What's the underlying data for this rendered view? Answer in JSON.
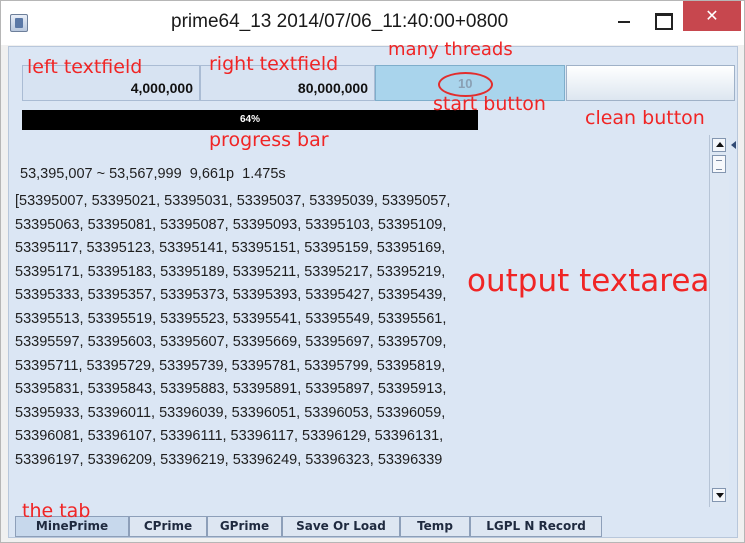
{
  "window": {
    "title": "prime64_13   2014/07/06_11:40:00+0800",
    "close_glyph": "✕"
  },
  "controls": {
    "left_field_value": "4,000,000",
    "right_field_value": "80,000,000",
    "threads_value": "10",
    "progress_percent": 64,
    "progress_text": "64%"
  },
  "output": {
    "summary": "53,395,007 ~ 53,567,999  9,661p  1.475s",
    "lines": [
      "[53395007, 53395021, 53395031, 53395037, 53395039, 53395057,",
      "53395063, 53395081, 53395087, 53395093, 53395103, 53395109,",
      "53395117, 53395123, 53395141, 53395151, 53395159, 53395169,",
      "53395171, 53395183, 53395189, 53395211, 53395217, 53395219,",
      "53395333, 53395357, 53395373, 53395393, 53395427, 53395439,",
      "53395513, 53395519, 53395523, 53395541, 53395549, 53395561,",
      "53395597, 53395603, 53395607, 53395669, 53395697, 53395709,",
      "53395711, 53395729, 53395739, 53395781, 53395799, 53395819,",
      "53395831, 53395843, 53395883, 53395891, 53395897, 53395913,",
      "53395933, 53396011, 53396039, 53396051, 53396053, 53396059,",
      "53396081, 53396107, 53396111, 53396117, 53396129, 53396131,",
      "53396197, 53396209, 53396219, 53396249, 53396323, 53396339"
    ]
  },
  "tabs": [
    {
      "label": "MinePrime",
      "selected": true
    },
    {
      "label": "CPrime",
      "selected": false
    },
    {
      "label": "GPrime",
      "selected": false
    },
    {
      "label": "Save Or Load",
      "selected": false
    },
    {
      "label": "Temp",
      "selected": false
    },
    {
      "label": "LGPL N Record",
      "selected": false
    }
  ],
  "annotations": {
    "left_textfield": "left textfield",
    "right_textfield": "right textfield",
    "many_threads": "many threads",
    "start_button": "start button",
    "clean_button": "clean button",
    "progress_bar": "progress bar",
    "output_textarea": "output textarea",
    "the_tab": "the tab"
  },
  "colors": {
    "annotation": "#f02525",
    "close_button": "#c7474e",
    "start_button": "#a9d4ec",
    "panel": "#dbe6f4",
    "progress_fill": "#000000"
  },
  "icons": [
    "app-icon",
    "minimize-icon",
    "maximize-icon",
    "close-icon",
    "scroll-up-icon",
    "scroll-down-icon"
  ]
}
